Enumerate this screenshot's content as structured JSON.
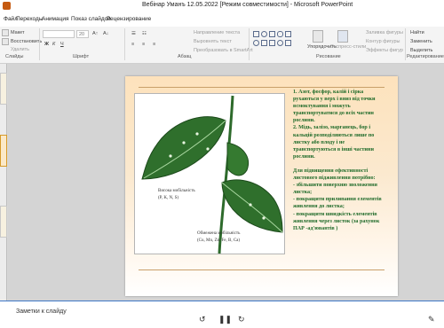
{
  "window": {
    "title": "Вебінар Уманъ 12.05.2022 [Режим совместимости] - Microsoft PowerPoint"
  },
  "tabs": [
    "Файл",
    "Переходы",
    "Анимация",
    "Показ слайдов",
    "Рецензирование"
  ],
  "ribbon": {
    "layout_btn": "Макет",
    "restore_btn": "Восстановить",
    "delete_btn": "Удалить",
    "font_size": "20",
    "text_direction": "Направление текста",
    "align_text": "Выровнять текст",
    "smartart": "Преобразовать в SmartArt",
    "arrange": "Упорядочить",
    "quick_styles": "Экспресс-стили",
    "shape_fill": "Заливка фигуры",
    "shape_outline": "Контур фигуры",
    "shape_effects": "Эффекты фигур",
    "find": "Найти",
    "replace": "Заменить",
    "select": "Выделить",
    "groups": {
      "slides": "Слайды",
      "font": "Шрифт",
      "paragraph": "Абзац",
      "drawing": "Рисование",
      "editing": "Редактирование"
    }
  },
  "slide": {
    "caption_high": "Висока мобільність",
    "caption_high_elements": "(P, K, N, S)",
    "caption_low": "Обмежена мобільність",
    "caption_low_elements": "(Cu, Mn, Zn, Fe, B, Ca)",
    "text": [
      "1. Азот, фосфор, калій і сірка",
      "рухаються у верх і вниз від точки",
      "всмоктування і можуть",
      "транспортуватися до всіх частин",
      "рослини.",
      "2. Мідь, залізо, марганець, бор і",
      "кальцій розподіляються лише по",
      "листку або плоду і не",
      "транспортуються в інші частини",
      "рослини.",
      "",
      "Для підвищення ефективності",
      "листового підживлення потрібно:",
      "- збільшити поверхню зволоження",
      "листка;",
      "- покращити прилипання елементів",
      "живлення до листка;",
      "- покращити швидкість елементів",
      "живлення через листок (за рахунок",
      "ПАР -ад'ювантів )"
    ]
  },
  "notes": {
    "label": "Заметки к слайду"
  }
}
